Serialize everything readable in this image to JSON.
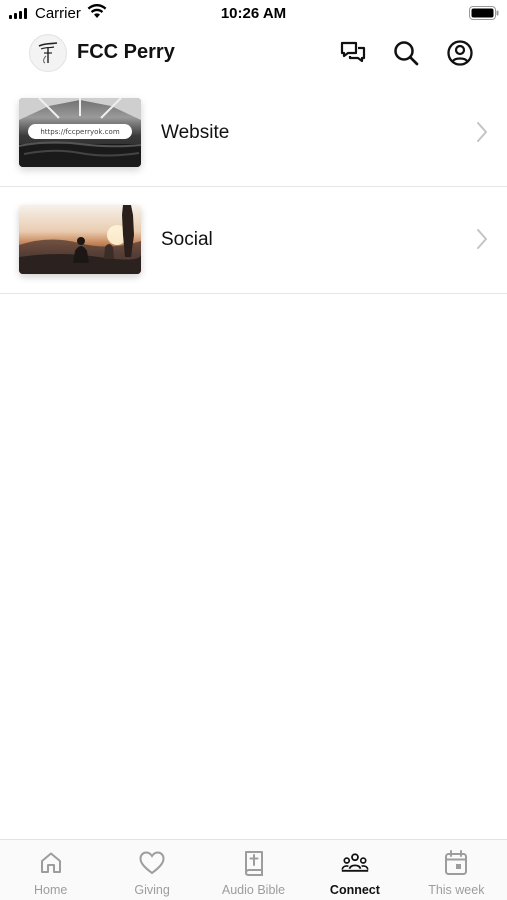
{
  "status_bar": {
    "carrier": "Carrier",
    "time": "10:26 AM"
  },
  "header": {
    "title": "FCC Perry",
    "icons": [
      "chat-icon",
      "search-icon",
      "profile-icon"
    ]
  },
  "list": {
    "items": [
      {
        "label": "Website",
        "thumbnail_text": "https://fccperryok.com"
      },
      {
        "label": "Social"
      }
    ]
  },
  "tab_bar": {
    "active": "Connect",
    "tabs": [
      {
        "label": "Home",
        "icon": "home-icon"
      },
      {
        "label": "Giving",
        "icon": "heart-icon"
      },
      {
        "label": "Audio Bible",
        "icon": "bible-icon"
      },
      {
        "label": "Connect",
        "icon": "people-icon"
      },
      {
        "label": "This week",
        "icon": "calendar-icon"
      }
    ]
  },
  "colors": {
    "active_tab": "#111111",
    "inactive_tab": "#9d9d9d",
    "divider": "#e6e6e6"
  }
}
